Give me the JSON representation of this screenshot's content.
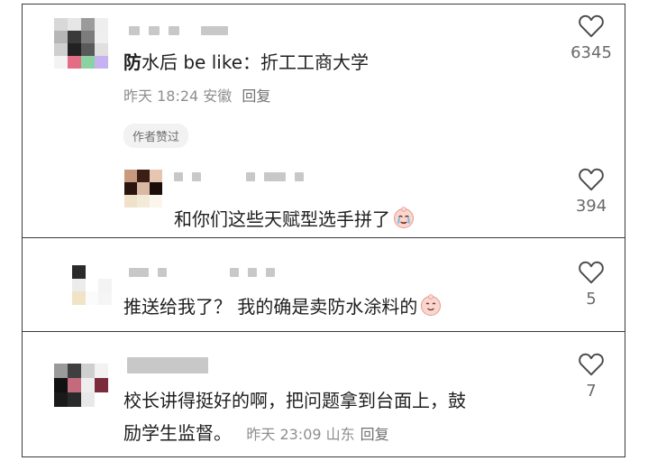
{
  "comments": [
    {
      "text_bold": "防",
      "text_rest": "水后 be like：折工工商大学",
      "meta": "昨天 18:24 安徽",
      "reply_label": "回复",
      "badge": "作者赞过",
      "likes": "6345",
      "reply": {
        "text": "和你们这些天赋型选手拼了",
        "emoji": "crying-face",
        "likes": "394"
      }
    },
    {
      "text": "推送给我了？ 我的确是卖防水涂料的",
      "emoji": "smiling-face",
      "likes": "5"
    },
    {
      "line1": "校长讲得挺好的啊，把问题拿到台面上，鼓",
      "line2": "励学生监督。",
      "meta": "昨天 23:09 山东",
      "reply_label": "回复",
      "likes": "7"
    }
  ],
  "colors": {
    "text": "#1f1f1f",
    "meta": "#8e8e8e",
    "badge_bg": "#f2f2f2",
    "icon": "#4a4a4a"
  }
}
